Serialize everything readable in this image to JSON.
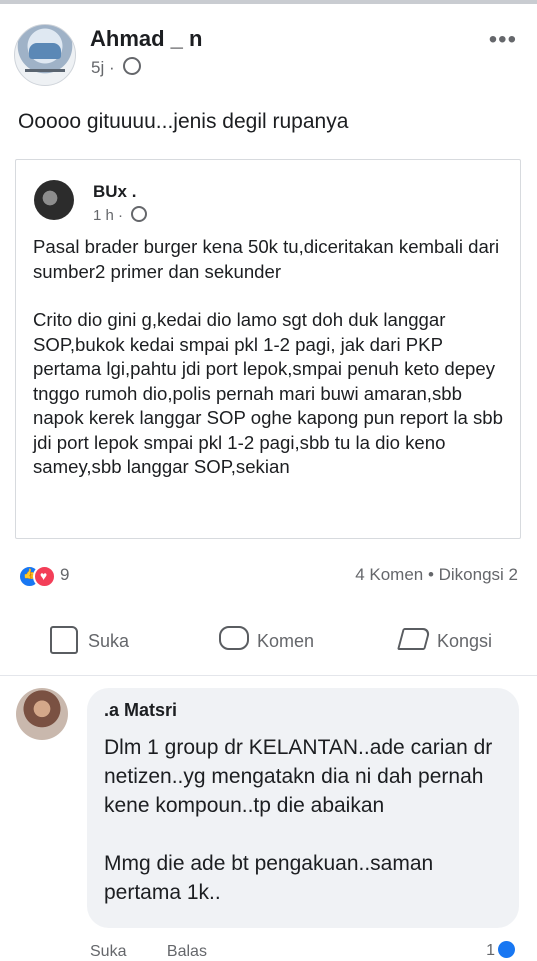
{
  "post": {
    "author": "Ahmad _ n",
    "time": "5j ·",
    "more": "•••",
    "text": "Ooooo gituuuu...jenis degil rupanya"
  },
  "shared": {
    "author": "BUx .",
    "time": "1 h ·",
    "paragraphs": [
      "Pasal brader burger kena 50k tu,diceritakan kembali dari sumber2 primer dan sekunder",
      "Crito dio gini g,kedai dio lamo sgt doh duk langgar SOP,bukok kedai smpai pkl 1-2 pagi, jak dari PKP pertama lgi,pahtu jdi port lepok,smpai penuh keto depey tnggo rumoh dio,polis pernah mari buwi amaran,sbb napok kerek langgar SOP oghe kapong pun report la sbb jdi port lepok smpai pkl 1-2 pagi,sbb tu la dio keno samey,sbb langgar SOP,sekian"
    ]
  },
  "stats": {
    "reaction_count": "9",
    "comments_shares": "4 Komen • Dikongsi 2"
  },
  "actions": {
    "like": "Suka",
    "comment": "Komen",
    "share": "Kongsi"
  },
  "comment": {
    "author": ".a Matsri",
    "paragraphs": [
      "Dlm 1 group dr KELANTAN..ade carian dr netizen..yg mengatakn dia ni dah pernah kene kompoun..tp die abaikan",
      "Mmg die ade bt pengakuan..saman pertama 1k.."
    ],
    "like_label": "Suka",
    "reply_label": "Balas",
    "like_count": "1"
  },
  "icons": [
    "globe-icon",
    "like-reaction-icon",
    "love-reaction-icon",
    "thumb-up-icon",
    "comment-icon",
    "share-icon"
  ],
  "colors": {
    "accent": "#1877f2",
    "love": "#f33e58",
    "muted": "#65676b",
    "bubble": "#f0f2f5"
  }
}
